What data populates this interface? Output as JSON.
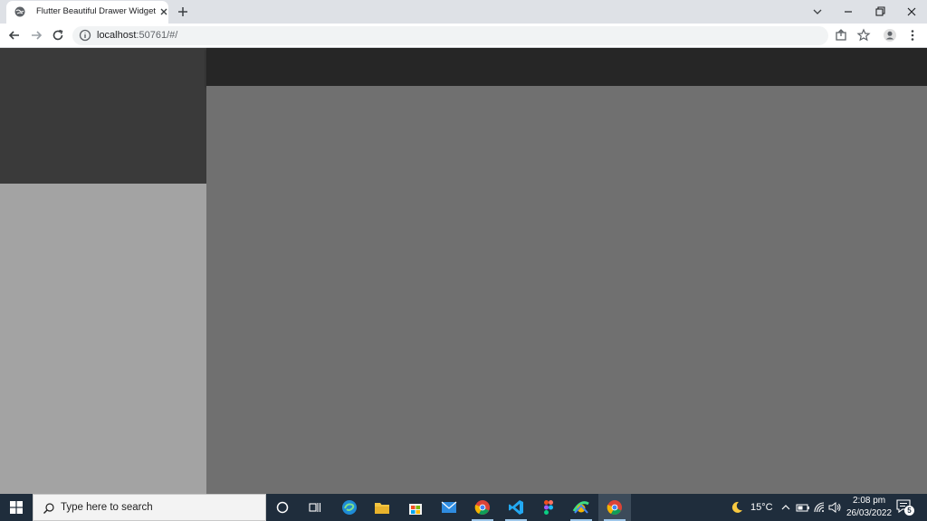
{
  "browser": {
    "tab_title": "Flutter Beautiful Drawer Widget",
    "url_host": "localhost",
    "url_rest": ":50761/#/"
  },
  "taskbar": {
    "search_placeholder": "Type here to search",
    "weather_temp": "15°C",
    "clock_time": "2:08 pm",
    "clock_date": "26/03/2022",
    "notification_count": "5"
  },
  "colors": {
    "drawer_header": "#3a3a3a",
    "drawer_body": "#a3a3a3",
    "appbar": "#262626",
    "content": "#707070",
    "taskbar": "#1f2d3c"
  }
}
